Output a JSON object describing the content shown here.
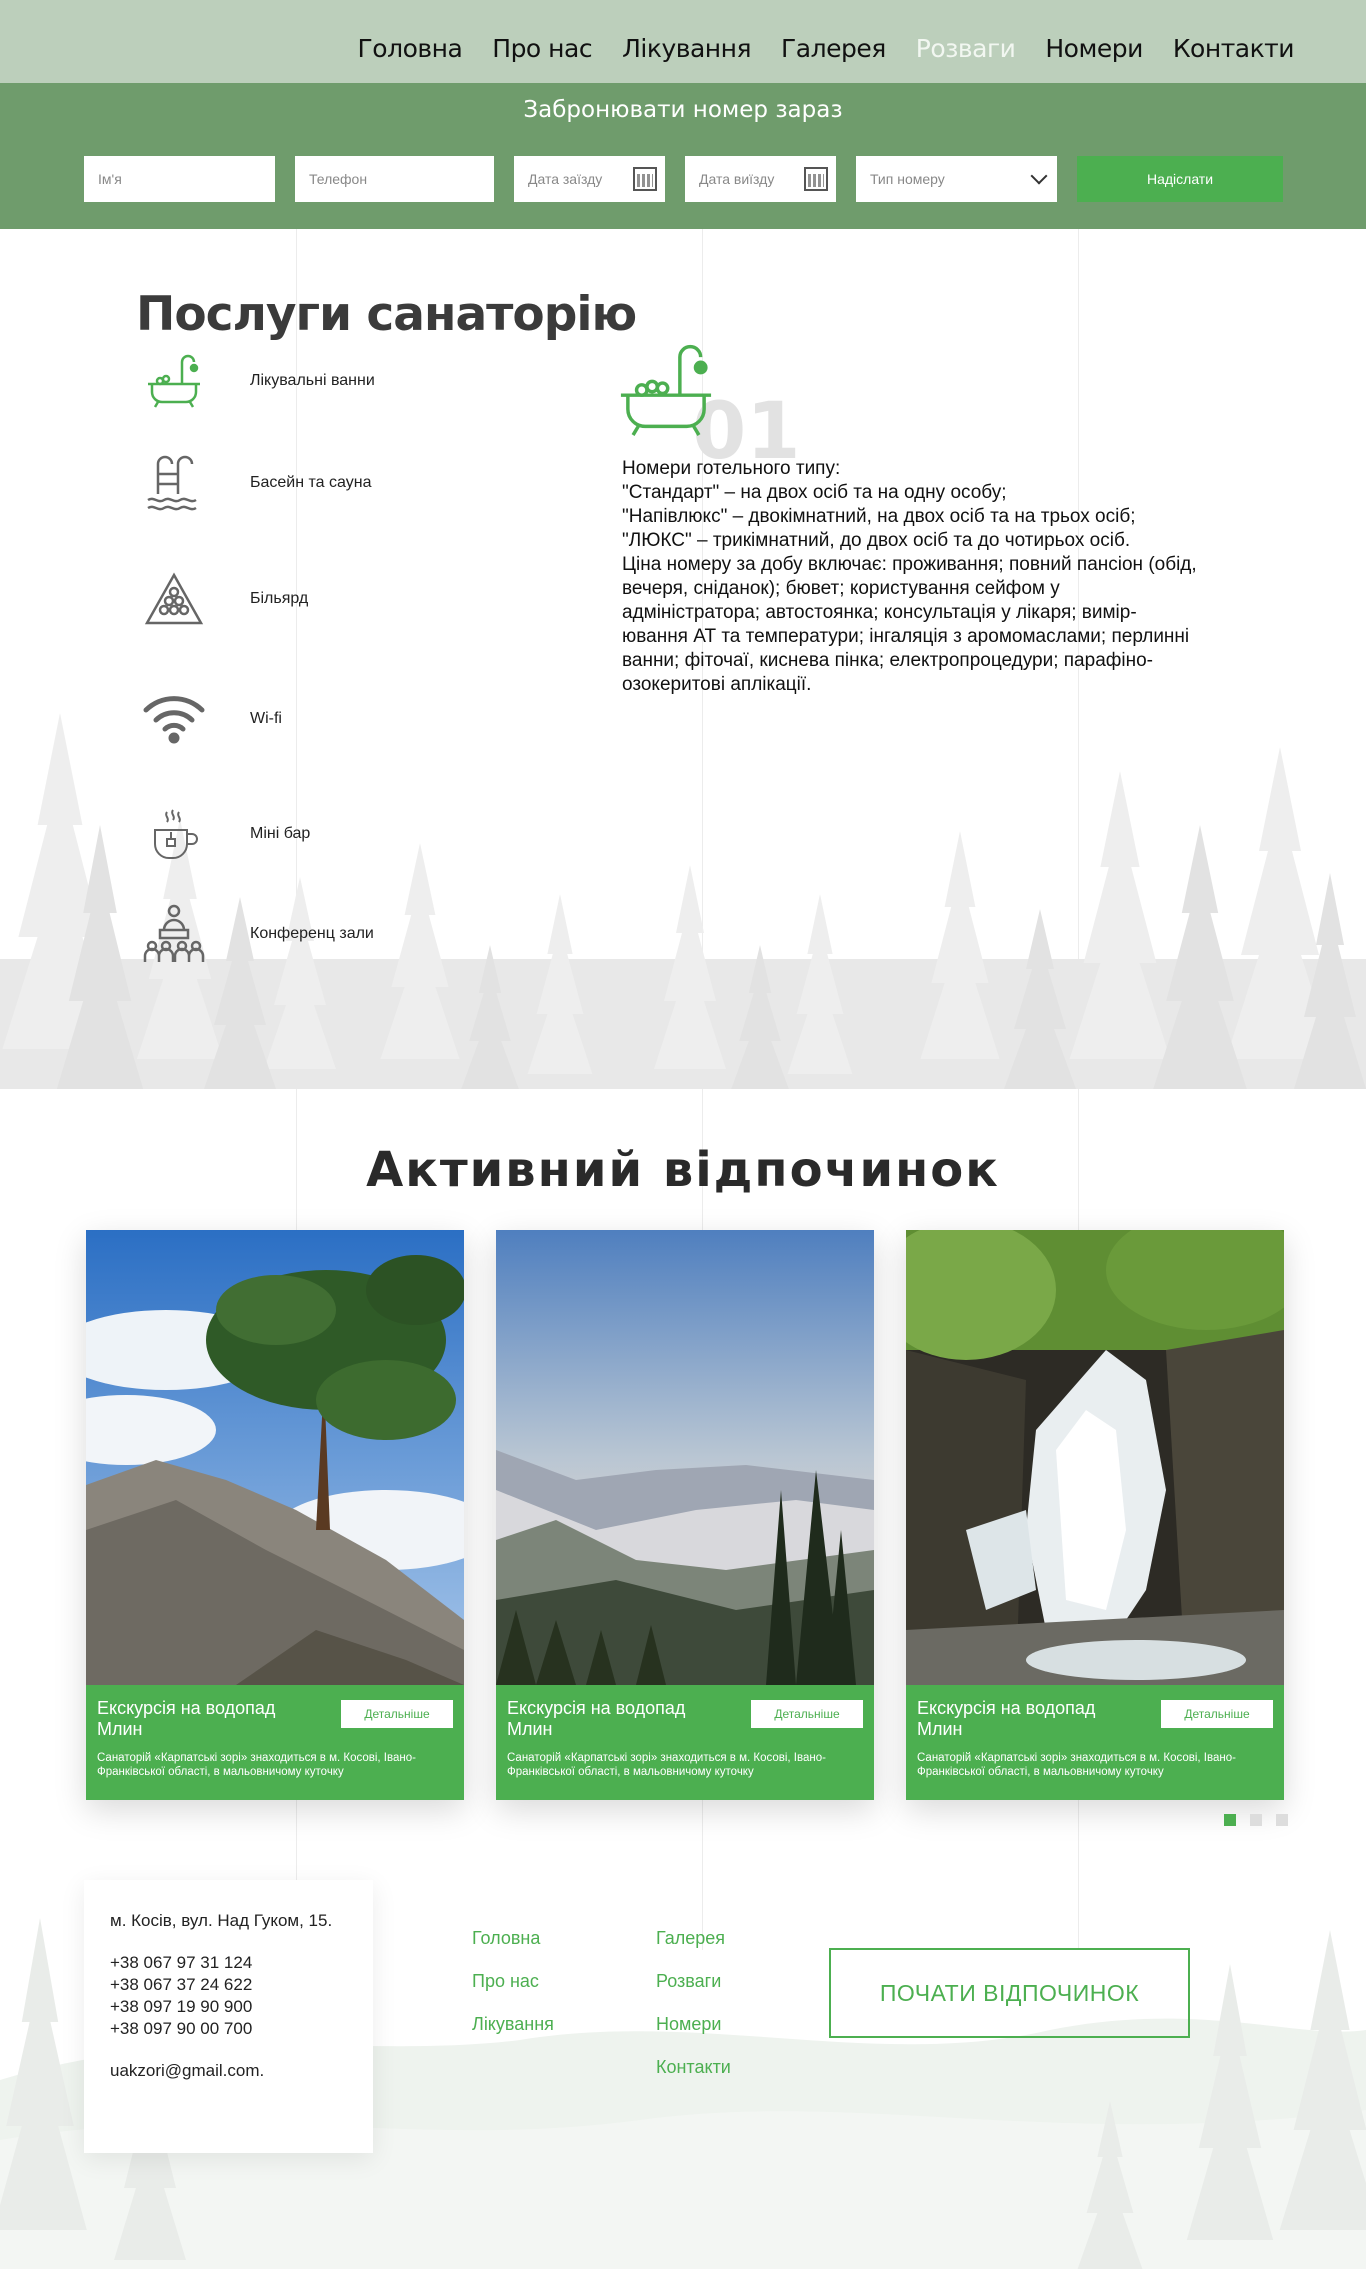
{
  "nav": {
    "items": [
      "Головна",
      "Про нас",
      "Лікування",
      "Галерея",
      "Розваги",
      "Номери",
      "Контакти"
    ],
    "active": "Розваги"
  },
  "booking": {
    "title": "Забронювати номер зараз",
    "name_placeholder": "Ім'я",
    "phone_placeholder": "Телефон",
    "checkin_placeholder": "Дата заїзду",
    "checkout_placeholder": "Дата виїзду",
    "room_type_placeholder": "Тип номеру",
    "submit_label": "Надіслати"
  },
  "services": {
    "title": "Послуги санаторію",
    "items": [
      {
        "label": "Лікувальні ванни",
        "icon": "bathtub-icon"
      },
      {
        "label": "Басейн та сауна",
        "icon": "pool-icon"
      },
      {
        "label": "Більярд",
        "icon": "billiard-icon"
      },
      {
        "label": "Wi-fi",
        "icon": "wifi-icon"
      },
      {
        "label": "Міні бар",
        "icon": "tea-cup-icon"
      },
      {
        "label": "Конференц зали",
        "icon": "conference-icon"
      }
    ],
    "detail": {
      "number": "01",
      "text": "Номери готельного типу:\n\"Стандарт\" – на двох осіб та на одну особу;\n\"Напівлюкс\" – двокімнатний, на двох осіб та на трьох осіб;\n\"ЛЮКС\" – трикімнатний, до двох осіб та до чотирьох осіб.\nЦіна номеру за добу включає: проживання; повний пансіон (обід, вечеря, сніданок); бювет; користування сейфом у адміністратора; автостоянка; консультація у лікаря; вимір-ювання АТ та температури; інгаляція з аромомаслами; перлинні ванни; фіточаї, киснева пінка; електропроцедури; парафіно-озокеритові аплікації."
    }
  },
  "active_rest": {
    "title": "Активний відпочинок",
    "cards": [
      {
        "title": "Екскурсія на водопад Млин",
        "button": "Детальніше",
        "description": "Санаторій «Карпатські зорі» знаходиться в м. Косові, Івано-Франківської області, в мальовничому куточку"
      },
      {
        "title": "Екскурсія на водопад Млин",
        "button": "Детальніше",
        "description": "Санаторій «Карпатські зорі» знаходиться в м. Косові, Івано-Франківської області, в мальовничому куточку"
      },
      {
        "title": "Екскурсія на водопад Млин",
        "button": "Детальніше",
        "description": "Санаторій «Карпатські зорі» знаходиться в м. Косові, Івано-Франківської області, в мальовничому куточку"
      }
    ]
  },
  "footer": {
    "address": "м. Косів, вул. Над Гуком, 15.",
    "phones": [
      "+38 067 97 31 124",
      "+38 067 37 24 622",
      "+38 097 19 90 900",
      "+38 097 90 00 700"
    ],
    "email": "uakzori@gmail.com.",
    "links_col1": [
      "Головна",
      "Про нас",
      "Лікування"
    ],
    "links_col2": [
      "Галерея",
      "Розваги",
      "Номери",
      "Контакти"
    ],
    "cta_label": "ПОЧАТИ ВІДПОЧИНОК"
  },
  "colors": {
    "accent": "#4caf50",
    "topbar": "#bccfbb",
    "booking_bar": "#6f9c6c"
  }
}
